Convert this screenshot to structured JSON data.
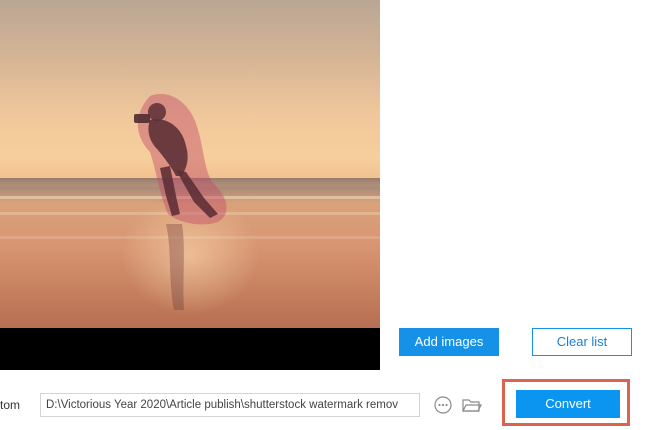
{
  "preview": {
    "image_alt": "Sunset beach photo with photographer silhouette highlighted"
  },
  "list_actions": {
    "add_images": "Add images",
    "clear_list": "Clear list"
  },
  "output": {
    "label": "tom",
    "path": "D:\\Victorious Year 2020\\Article publish\\shutterstock watermark remov",
    "more_icon": "ellipsis-circle-icon",
    "folder_icon": "folder-icon"
  },
  "convert": {
    "label": "Convert"
  },
  "colors": {
    "accent": "#0a95f0",
    "highlight_border": "#d9644f",
    "selection_mask": "#c04b68"
  }
}
